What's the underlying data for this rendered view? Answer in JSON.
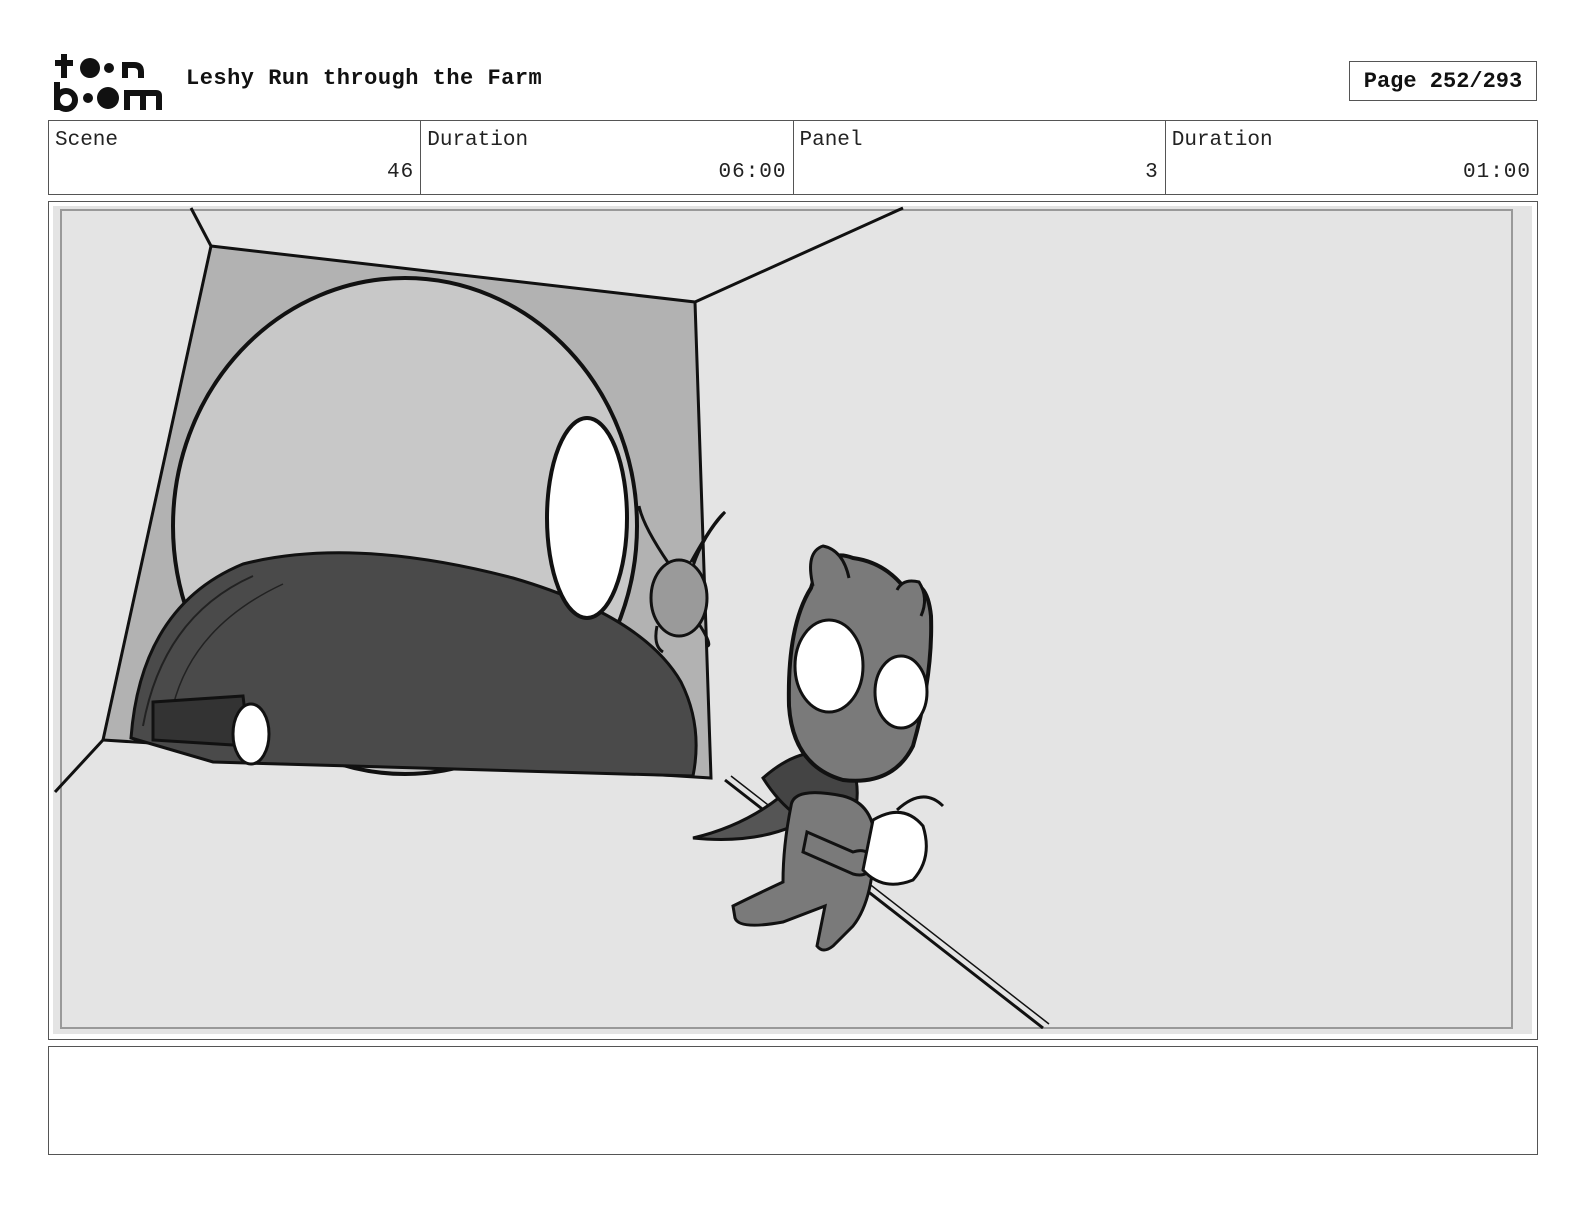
{
  "header": {
    "logo_text": "toon boom",
    "title": "Leshy Run through the Farm",
    "page_label": "Page 252/293"
  },
  "info": {
    "scene_label": "Scene",
    "scene_value": "46",
    "scene_duration_label": "Duration",
    "scene_duration_value": "06:00",
    "panel_label": "Panel",
    "panel_value": "3",
    "panel_duration_label": "Duration",
    "panel_duration_value": "01:00"
  },
  "panel": {
    "image_icon": "storyboard-sketch",
    "palette": {
      "ceiling": "#e4e4e4",
      "wall": "#b2b2b2",
      "machine": "#c8c8c8",
      "shadow": "#4a4a4a",
      "character": "#7a7a7a",
      "ink": "#111111"
    }
  },
  "notes": {
    "text": ""
  }
}
